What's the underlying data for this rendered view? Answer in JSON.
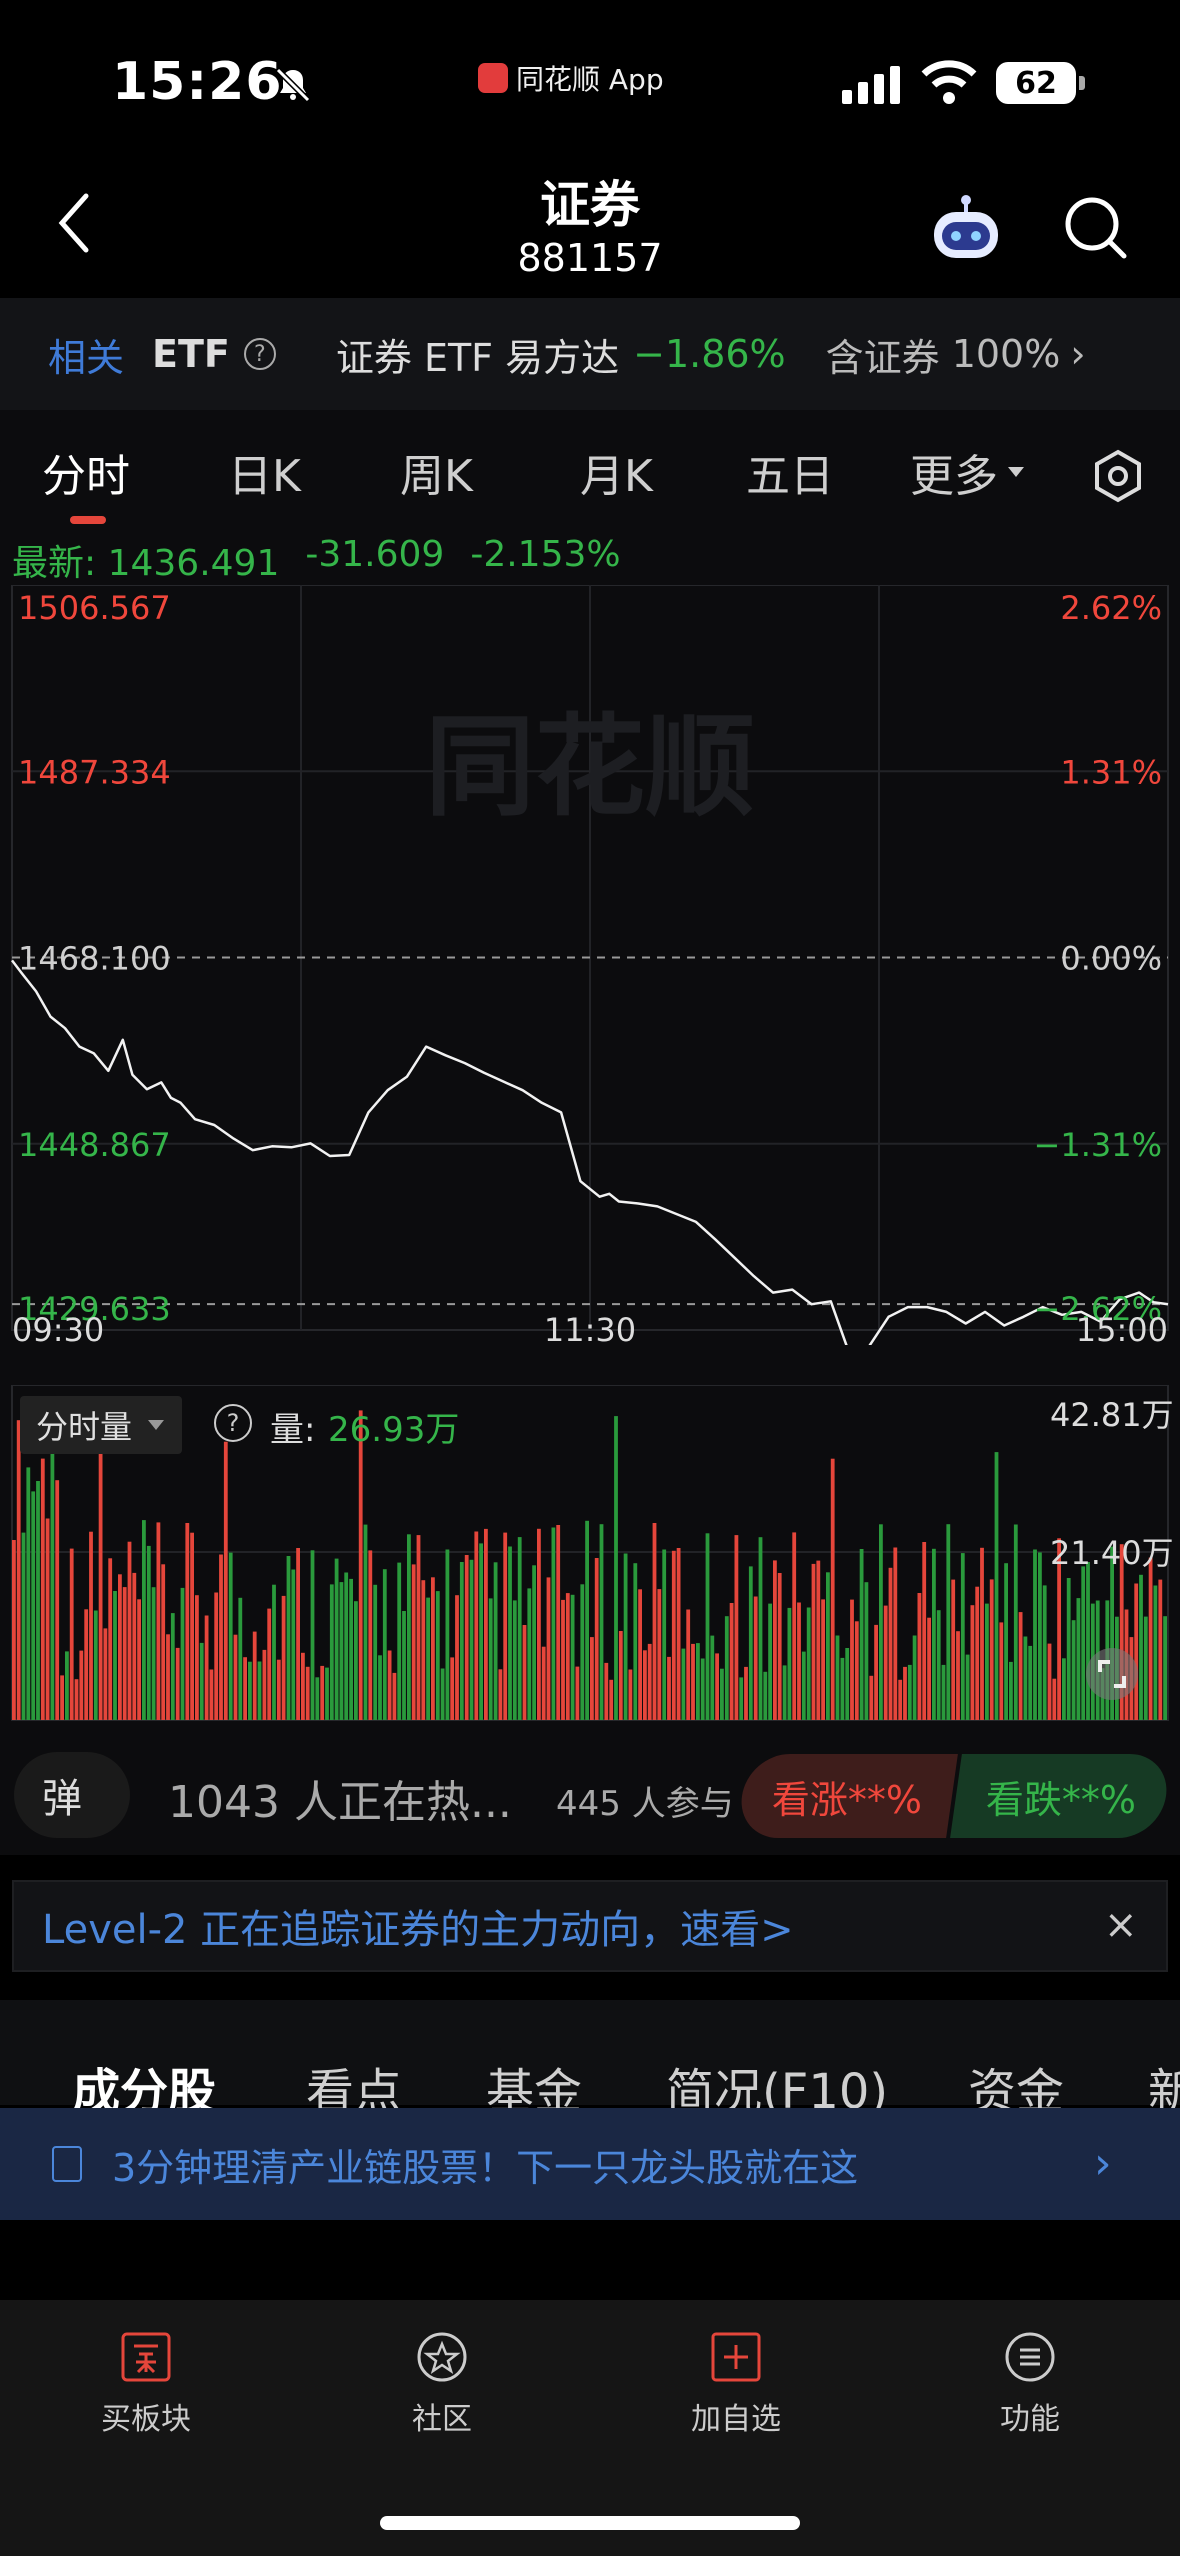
{
  "status_bar": {
    "time": "15:26",
    "app_name": "同花顺 App",
    "battery": "62"
  },
  "header": {
    "title": "证券",
    "code": "881157"
  },
  "etf_bar": {
    "related": "相关",
    "etf": "ETF",
    "question": "?",
    "name": "证券 ETF 易方达",
    "change": "−1.86%",
    "contains_label": "含证券",
    "contains_pct": "100%",
    "arrow": "›"
  },
  "tabs": [
    {
      "label": "分时"
    },
    {
      "label": "日K"
    },
    {
      "label": "周K"
    },
    {
      "label": "月K"
    },
    {
      "label": "五日"
    },
    {
      "label": "更多"
    }
  ],
  "latest": {
    "label": "最新:",
    "price": "1436.491",
    "change": "-31.609",
    "pct": "-2.153%"
  },
  "watermark": "同花顺",
  "chart_data": {
    "type": "line",
    "title": "",
    "xlabel": "",
    "ylabel": "",
    "x_ticks": [
      "09:30",
      "11:30",
      "15:00"
    ],
    "y_ticks": [
      {
        "price": "1506.567",
        "pct": "2.62%",
        "color": "red"
      },
      {
        "price": "1487.334",
        "pct": "1.31%",
        "color": "red"
      },
      {
        "price": "1468.100",
        "pct": "0.00%",
        "color": "grey"
      },
      {
        "price": "1448.867",
        "pct": "−1.31%",
        "color": "green"
      },
      {
        "price": "1429.633",
        "pct": "−2.62%",
        "color": "green"
      }
    ],
    "ylim": [
      1429.633,
      1506.567
    ],
    "prev_close": 1468.1,
    "x_minutes": 240,
    "series": [
      {
        "x": [
          0,
          2,
          5,
          8,
          11,
          14,
          17,
          20,
          23,
          25,
          28,
          31,
          33,
          35,
          38,
          42,
          46,
          50,
          54,
          58,
          62,
          66,
          70,
          74,
          78,
          82,
          86,
          90,
          94,
          98,
          102,
          106,
          110,
          114,
          118,
          122,
          124,
          126,
          130,
          134,
          138,
          142,
          146,
          150,
          154,
          158,
          162,
          166,
          170,
          174,
          178,
          182,
          186,
          190,
          194,
          198,
          202,
          206,
          210,
          214,
          218,
          222,
          226,
          230,
          234,
          237,
          240
        ],
        "y": [
          1467.8,
          1466.5,
          1464.6,
          1462.0,
          1460.8,
          1458.9,
          1458.2,
          1456.4,
          1459.6,
          1456.0,
          1454.5,
          1455.2,
          1453.6,
          1453.1,
          1451.4,
          1450.8,
          1449.4,
          1448.2,
          1448.6,
          1448.5,
          1448.9,
          1447.6,
          1447.7,
          1452.1,
          1454.4,
          1455.8,
          1458.9,
          1458.0,
          1457.2,
          1456.2,
          1455.3,
          1454.4,
          1453.1,
          1452.1,
          1445.0,
          1443.4,
          1443.7,
          1442.9,
          1442.7,
          1442.4,
          1441.6,
          1440.8,
          1439.0,
          1437.1,
          1435.2,
          1433.5,
          1433.8,
          1432.3,
          1432.6,
          1427.0,
          1428.0,
          1431.0,
          1432.0,
          1432.0,
          1431.5,
          1430.3,
          1431.5,
          1430.1,
          1431.0,
          1432.0,
          1431.2,
          1431.5,
          1430.5,
          1432.8,
          1433.5,
          1432.5,
          1432.3
        ]
      }
    ]
  },
  "volume": {
    "control": "分时量",
    "question": "?",
    "label": "量:",
    "value": "26.93万",
    "max": "42.81万",
    "mid": "21.40万"
  },
  "danmu": {
    "button": "弹",
    "text": "1043 人正在热...",
    "participants": "445 人参与",
    "bull": "看涨**%",
    "bear": "看跌**%"
  },
  "level2": {
    "text": "Level-2 正在追踪证券的主力动向，速看>",
    "close": "×"
  },
  "sub_tabs": [
    {
      "label": "成分股"
    },
    {
      "label": "看点"
    },
    {
      "label": "基金"
    },
    {
      "label": "简况(F10)"
    },
    {
      "label": "资金"
    },
    {
      "label": "新"
    }
  ],
  "banner": {
    "text": "3分钟理清产业链股票！下一只龙头股就在这",
    "arrow": "›"
  },
  "bottom_nav": [
    {
      "label": "买板块",
      "icon": "buy-icon"
    },
    {
      "label": "社区",
      "icon": "community-icon"
    },
    {
      "label": "加自选",
      "icon": "add-watchlist-icon"
    },
    {
      "label": "功能",
      "icon": "menu-icon"
    }
  ],
  "colors": {
    "up": "#f0473c",
    "down": "#35b54a",
    "accent": "#4b86da",
    "background": "#0c0c0e"
  }
}
